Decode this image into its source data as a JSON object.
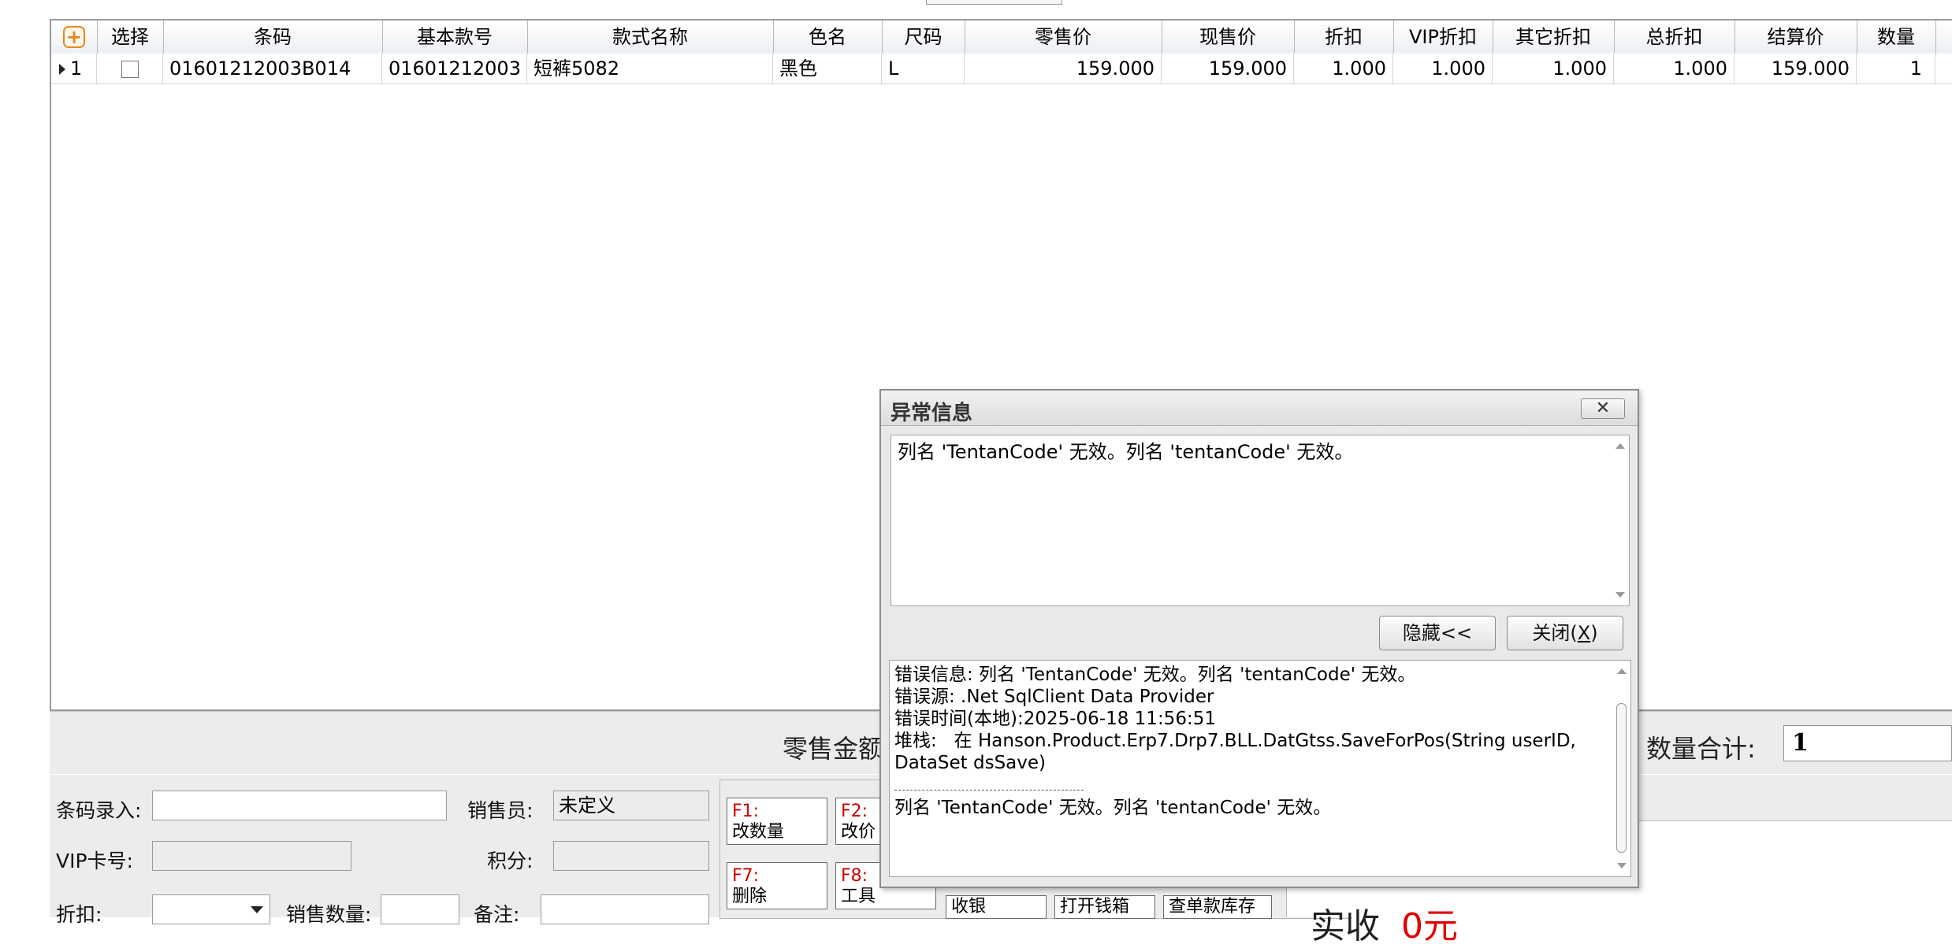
{
  "grid": {
    "headers": [
      "",
      "选择",
      "条码",
      "基本款号",
      "款式名称",
      "色名",
      "尺码",
      "零售价",
      "现售价",
      "折扣",
      "VIP折扣",
      "其它折扣",
      "总折扣",
      "结算价",
      "数量"
    ],
    "row": {
      "index": "1",
      "barcode": "01601212003B014",
      "base_style": "01601212003",
      "style_name": "短裤5082",
      "color": "黑色",
      "size": "L",
      "retail_price": "159.000",
      "current_price": "159.000",
      "discount": "1.000",
      "vip_discount": "1.000",
      "other_discount": "1.000",
      "total_discount": "1.000",
      "settle_price": "159.000",
      "qty": "1"
    }
  },
  "summary": {
    "retail_amount_label": "零售金额",
    "qty_total_label": "数量合计:",
    "qty_total_value": "1"
  },
  "form": {
    "barcode_label": "条码录入:",
    "barcode_value": "",
    "salesperson_label": "销售员:",
    "salesperson_value": "未定义",
    "vip_label": "VIP卡号:",
    "vip_value": "",
    "points_label": "积分:",
    "points_value": "",
    "discount_label": "折扣:",
    "discount_value": "",
    "sale_qty_label": "销售数量:",
    "sale_qty_value": "",
    "remark_label": "备注:",
    "remark_value": ""
  },
  "fkeys": [
    {
      "key": "F1:",
      "label": "改数量"
    },
    {
      "key": "F2:",
      "label": "改价"
    },
    {
      "key": "F7:",
      "label": "删除"
    },
    {
      "key": "F8:",
      "label": "工具"
    }
  ],
  "bottom_buttons": [
    "收银",
    "打开钱箱",
    "查单款库存"
  ],
  "paid": {
    "label": "实收",
    "value": "0元"
  },
  "dialog": {
    "title": "异常信息",
    "close_glyph": "✕",
    "message": "列名 'TentanCode' 无效。列名 'tentanCode' 无效。",
    "hide_button": "隐藏<<",
    "close_button_text": "关闭(",
    "close_button_key": "X",
    "close_button_end": ")",
    "detail": {
      "error_info": "错误信息: 列名 'TentanCode' 无效。列名 'tentanCode' 无效。",
      "error_source": "错误源: .Net SqlClient Data Provider",
      "error_time": "错误时间(本地):2025-06-18 11:56:51",
      "stack_line1": "堆栈:   在 Hanson.Product.Erp7.Drp7.BLL.DatGtss.SaveForPos(String userID,",
      "stack_line2": "DataSet dsSave)",
      "message_repeat": "列名 'TentanCode' 无效。列名 'tentanCode' 无效。"
    }
  }
}
